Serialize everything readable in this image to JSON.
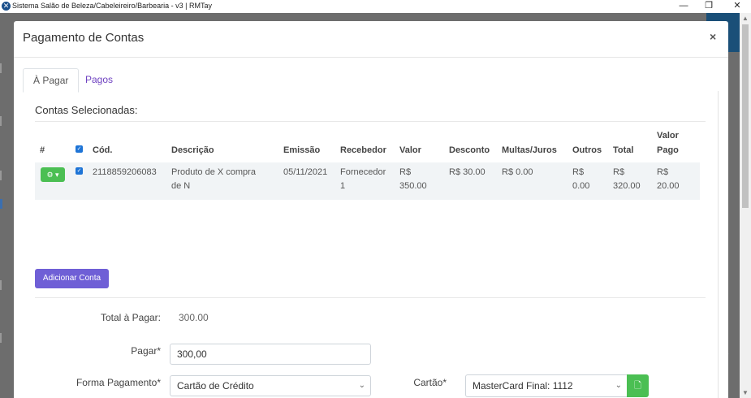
{
  "window": {
    "title": "Sistema Salão de Beleza/Cabeleireiro/Barbearia - v3 | RMTay",
    "minimize": "—",
    "maximize": "❐",
    "close": "✕"
  },
  "modal": {
    "title": "Pagamento de Contas",
    "close": "×",
    "tabs": [
      {
        "label": "À Pagar",
        "active": true
      },
      {
        "label": "Pagos",
        "active": false
      }
    ],
    "section_title": "Contas Selecionadas:",
    "table": {
      "headers": {
        "hash": "#",
        "cod": "Cód.",
        "descricao": "Descrição",
        "emissao": "Emissão",
        "recebedor": "Recebedor",
        "valor": "Valor",
        "desconto": "Desconto",
        "multas": "Multas/Juros",
        "outros": "Outros",
        "total": "Total",
        "valor_pago_1": "Valor",
        "valor_pago_2": "Pago"
      },
      "rows": [
        {
          "cod": "2118859206083",
          "descricao_1": "Produto de X compra",
          "descricao_2": "de N",
          "emissao": "05/11/2021",
          "recebedor_1": "Fornecedor",
          "recebedor_2": "1",
          "valor_1": "R$",
          "valor_2": "350.00",
          "desconto": "R$ 30.00",
          "multas": "R$ 0.00",
          "outros_1": "R$",
          "outros_2": "0.00",
          "total_1": "R$",
          "total_2": "320.00",
          "pago_1": "R$",
          "pago_2": "20.00"
        }
      ]
    },
    "add_button": "Adicionar Conta",
    "form": {
      "total_label": "Total à Pagar:",
      "total_value": "300.00",
      "pagar_label": "Pagar*",
      "pagar_value": "300,00",
      "forma_label": "Forma Pagamento*",
      "forma_value": "Cartão de Crédito",
      "cartao_label": "Cartão*",
      "cartao_value": "MasterCard Final: 1112"
    }
  },
  "colors": {
    "accent_purple": "#6f5fd6",
    "success_green": "#4bbf53",
    "checkbox_blue": "#1e74d6"
  },
  "icons": [
    "gear-icon",
    "chevron-down-icon",
    "document-icon",
    "checkbox-checked-icon"
  ]
}
